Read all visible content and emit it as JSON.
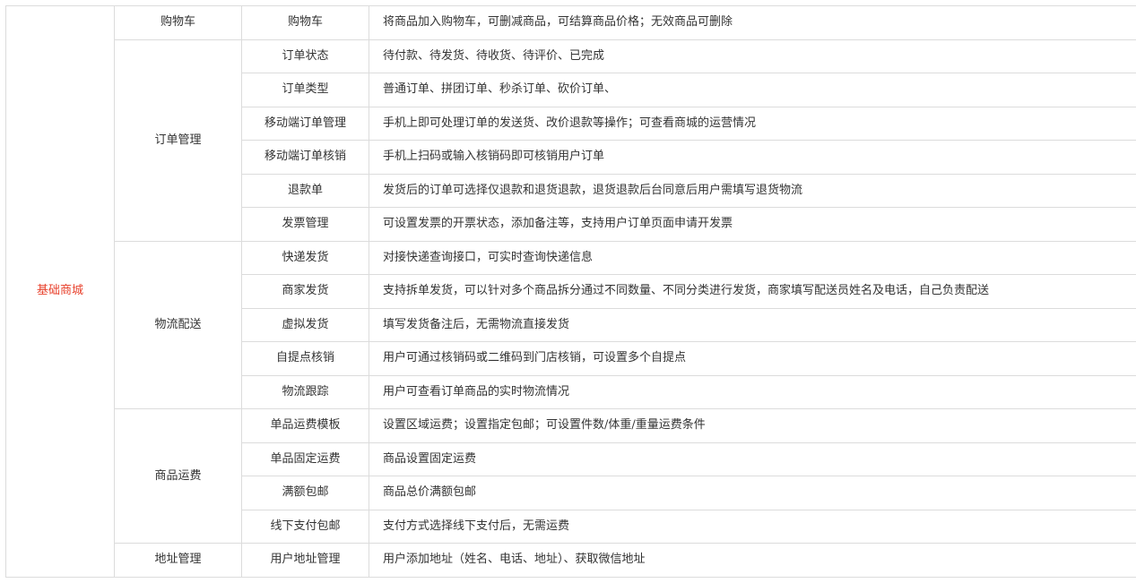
{
  "top_category": "基础商城",
  "accent_color": "#e8412c",
  "groups": [
    {
      "name": "购物车",
      "features": [
        {
          "name": "购物车",
          "desc": "将商品加入购物车，可删减商品，可结算商品价格；无效商品可删除"
        }
      ]
    },
    {
      "name": "订单管理",
      "features": [
        {
          "name": "订单状态",
          "desc": "待付款、待发货、待收货、待评价、已完成"
        },
        {
          "name": "订单类型",
          "desc": "普通订单、拼团订单、秒杀订单、砍价订单、"
        },
        {
          "name": "移动端订单管理",
          "desc": "手机上即可处理订单的发送货、改价退款等操作；可查看商城的运营情况"
        },
        {
          "name": "移动端订单核销",
          "desc": "手机上扫码或输入核销码即可核销用户订单"
        },
        {
          "name": "退款单",
          "desc": "发货后的订单可选择仅退款和退货退款，退货退款后台同意后用户需填写退货物流"
        },
        {
          "name": "发票管理",
          "desc": "可设置发票的开票状态，添加备注等，支持用户订单页面申请开发票"
        }
      ]
    },
    {
      "name": "物流配送",
      "features": [
        {
          "name": "快递发货",
          "desc": "对接快递查询接口，可实时查询快递信息"
        },
        {
          "name": "商家发货",
          "desc": "支持拆单发货，可以针对多个商品拆分通过不同数量、不同分类进行发货，商家填写配送员姓名及电话，自己负责配送"
        },
        {
          "name": "虚拟发货",
          "desc": "填写发货备注后，无需物流直接发货"
        },
        {
          "name": "自提点核销",
          "desc": "用户可通过核销码或二维码到门店核销，可设置多个自提点"
        },
        {
          "name": "物流跟踪",
          "desc": "用户可查看订单商品的实时物流情况"
        }
      ]
    },
    {
      "name": "商品运费",
      "features": [
        {
          "name": "单品运费模板",
          "desc": "设置区域运费；设置指定包邮；可设置件数/体重/重量运费条件"
        },
        {
          "name": "单品固定运费",
          "desc": "商品设置固定运费"
        },
        {
          "name": "满额包邮",
          "desc": "商品总价满额包邮"
        },
        {
          "name": "线下支付包邮",
          "desc": "支付方式选择线下支付后，无需运费"
        }
      ]
    },
    {
      "name": "地址管理",
      "features": [
        {
          "name": "用户地址管理",
          "desc": "用户添加地址（姓名、电话、地址）、获取微信地址"
        }
      ]
    }
  ]
}
